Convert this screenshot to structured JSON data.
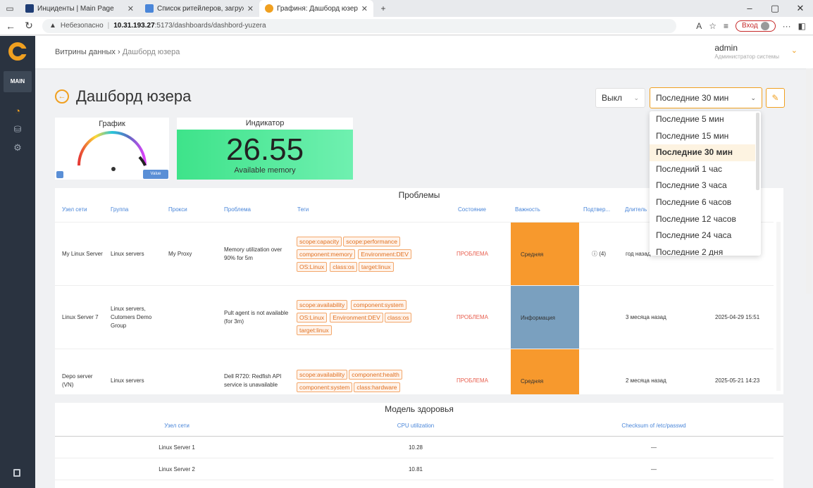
{
  "browser": {
    "tabs": [
      {
        "title": "Инциденты | Main Page",
        "color": "#1f3d75"
      },
      {
        "title": "Список ритейлеров, загружаемых",
        "color": "#4a86d9"
      },
      {
        "title": "Графиня: Дашборд юзера",
        "color": "#f0a020"
      }
    ],
    "url_warning": "Небезопасно",
    "url_host": "10.31.193.27",
    "url_path": ":5173/dashboards/dashbord-yuzera",
    "login_label": "Вход"
  },
  "sidebar": {
    "main_label": "MAIN"
  },
  "header": {
    "breadcrumb_root": "Витрины данных",
    "breadcrumb_current": "Дашборд юзера",
    "user_name": "admin",
    "user_role": "Администратор системы"
  },
  "dashboard": {
    "title": "Дашборд юзера",
    "refresh_value": "Выкл",
    "period_value": "Последние 30 мин",
    "period_options": [
      "Последние 5 мин",
      "Последние 15 мин",
      "Последние 30 мин",
      "Последний 1 час",
      "Последние 3 часа",
      "Последние 6 часов",
      "Последние 12 часов",
      "Последние 24 часа",
      "Последние 2 дня"
    ],
    "selected_period_index": 2
  },
  "widgets": {
    "graph": {
      "label": "График",
      "badge": "Value"
    },
    "indicator": {
      "label": "Индикатор",
      "value": "26.55",
      "subtitle": "Available memory",
      "color": "#3ee38a"
    }
  },
  "problems": {
    "title": "Проблемы",
    "columns": [
      "Узел сети",
      "Группа",
      "Прокси",
      "Проблема",
      "Теги",
      "Состояние",
      "Важность",
      "Подтвер...",
      "Длитель"
    ],
    "rows": [
      {
        "host": "My Linux Server",
        "group": "Linux servers",
        "proxy": "My Proxy",
        "problem": "Memory utilization over 90% for 5m",
        "tags": [
          "scope:capacity",
          "scope:performance",
          "component:memory",
          "Environment:DEV",
          "OS:Linux",
          "class:os",
          "target:linux"
        ],
        "status": "ПРОБЛЕМА",
        "severity": "Средняя",
        "ack": "(4)",
        "duration": "год назад",
        "time": ""
      },
      {
        "host": "Linux Server 7",
        "group": "Linux servers, Cutomers Demo Group",
        "proxy": "",
        "problem": "Pult agent is not available (for 3m)",
        "tags": [
          "scope:availability",
          "component:system",
          "OS:Linux",
          "Environment:DEV",
          "class:os",
          "target:linux"
        ],
        "status": "ПРОБЛЕМА",
        "severity": "Информация",
        "ack": "",
        "duration": "3 месяца назад",
        "time": "2025-04-29 15:51"
      },
      {
        "host": "Depo server (VN)",
        "group": "Linux servers",
        "proxy": "",
        "problem": "Dell R720: Redfish API service is unavailable",
        "tags": [
          "scope:availability",
          "component:health",
          "component:system",
          "class:hardware"
        ],
        "status": "ПРОБЛЕМА",
        "severity": "Средняя",
        "ack": "",
        "duration": "2 месяца назад",
        "time": "2025-05-21 14:23"
      }
    ]
  },
  "health": {
    "title": "Модель здоровья",
    "columns": [
      "Узел сети",
      "CPU utilization",
      "Checksum of /etc/passwd"
    ],
    "rows": [
      {
        "host": "Linux Server 1",
        "cpu": "10.28",
        "checksum": "—"
      },
      {
        "host": "Linux Server 2",
        "cpu": "10.81",
        "checksum": "—"
      }
    ]
  },
  "colors": {
    "accent": "#f0a020",
    "sidebar": "#2a3340",
    "severity_mid": "#f7992d",
    "severity_info": "#7aa0bf",
    "link_blue": "#4a86d9"
  }
}
